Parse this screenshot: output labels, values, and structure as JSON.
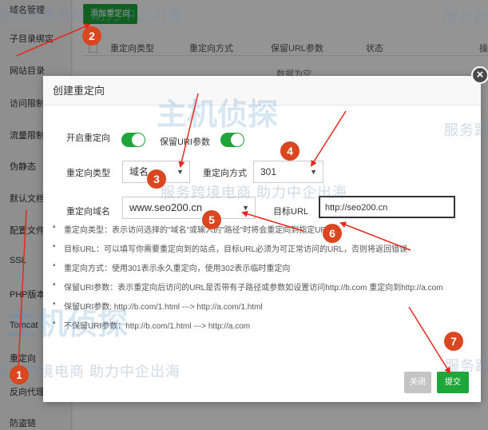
{
  "sidebar": {
    "items": [
      {
        "label": "域名管理"
      },
      {
        "label": "子目录绑定"
      },
      {
        "label": "网站目录"
      },
      {
        "label": "访问限制"
      },
      {
        "label": "流量限制"
      },
      {
        "label": "伪静态"
      },
      {
        "label": "默认文档"
      },
      {
        "label": "配置文件"
      },
      {
        "label": "SSL"
      },
      {
        "label": "PHP版本"
      },
      {
        "label": "Tomcat"
      },
      {
        "label": "重定向"
      },
      {
        "label": "反向代理"
      },
      {
        "label": "防盗链"
      }
    ]
  },
  "background": {
    "add_button": "添加重定向",
    "columns": [
      "重定向类型",
      "重定向方式",
      "保留URL参数",
      "状态",
      "操"
    ],
    "empty": "数据为空"
  },
  "dialog": {
    "title": "创建重定向",
    "close_glyph": "×",
    "enable_label": "开启重定向",
    "enable_on": true,
    "keep_params_label": "保留URI参数",
    "keep_params_on": true,
    "type_label": "重定向类型",
    "type_value": "域名",
    "method_label": "重定向方式",
    "method_value": "301",
    "domain_label": "重定向域名",
    "domain_value": "www.seo200.cn",
    "target_label": "目标URL",
    "target_value": "http://seo200.cn",
    "caret": "▼",
    "tips": [
      "重定向类型：表示访问选择的\"域名\"或输入的\"路径\"时将会重定向到指定URL",
      "目标URL：可以填写你需要重定向到的站点，目标URL必须为可正常访问的URL，否则将返回错误",
      "重定向方式：使用301表示永久重定向，使用302表示临时重定向",
      "保留URI参数：表示重定向后访问的URL是否带有子路径或参数如设置访问http://b.com 重定向到http://a.com",
      "保留URI参数:  http://b.com/1.html ---> http://a.com/1.html",
      "不保留URI参数：http://b.com/1.html ---> http://a.com"
    ],
    "close_button": "关闭",
    "submit_button": "提交"
  },
  "markers": [
    "1",
    "2",
    "3",
    "4",
    "5",
    "6",
    "7"
  ],
  "watermark": {
    "slogan": "服务跨境电商 助力中企出海",
    "short": "服务跨",
    "brand": "主机侦探",
    "service_tail": "服务跨",
    "corner": "服务跨"
  },
  "colors": {
    "accent_green": "#20a53a",
    "marker_red": "#d9461f",
    "arrow_red": "#e8281e"
  }
}
